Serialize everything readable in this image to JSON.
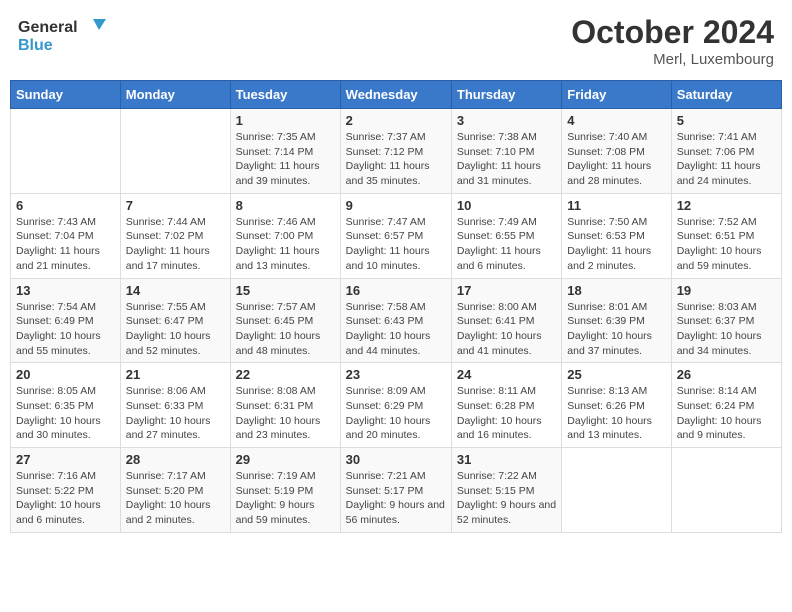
{
  "logo": {
    "general": "General",
    "blue": "Blue"
  },
  "title": "October 2024",
  "subtitle": "Merl, Luxembourg",
  "days_of_week": [
    "Sunday",
    "Monday",
    "Tuesday",
    "Wednesday",
    "Thursday",
    "Friday",
    "Saturday"
  ],
  "weeks": [
    [
      {
        "day": "",
        "info": ""
      },
      {
        "day": "",
        "info": ""
      },
      {
        "day": "1",
        "info": "Sunrise: 7:35 AM\nSunset: 7:14 PM\nDaylight: 11 hours and 39 minutes."
      },
      {
        "day": "2",
        "info": "Sunrise: 7:37 AM\nSunset: 7:12 PM\nDaylight: 11 hours and 35 minutes."
      },
      {
        "day": "3",
        "info": "Sunrise: 7:38 AM\nSunset: 7:10 PM\nDaylight: 11 hours and 31 minutes."
      },
      {
        "day": "4",
        "info": "Sunrise: 7:40 AM\nSunset: 7:08 PM\nDaylight: 11 hours and 28 minutes."
      },
      {
        "day": "5",
        "info": "Sunrise: 7:41 AM\nSunset: 7:06 PM\nDaylight: 11 hours and 24 minutes."
      }
    ],
    [
      {
        "day": "6",
        "info": "Sunrise: 7:43 AM\nSunset: 7:04 PM\nDaylight: 11 hours and 21 minutes."
      },
      {
        "day": "7",
        "info": "Sunrise: 7:44 AM\nSunset: 7:02 PM\nDaylight: 11 hours and 17 minutes."
      },
      {
        "day": "8",
        "info": "Sunrise: 7:46 AM\nSunset: 7:00 PM\nDaylight: 11 hours and 13 minutes."
      },
      {
        "day": "9",
        "info": "Sunrise: 7:47 AM\nSunset: 6:57 PM\nDaylight: 11 hours and 10 minutes."
      },
      {
        "day": "10",
        "info": "Sunrise: 7:49 AM\nSunset: 6:55 PM\nDaylight: 11 hours and 6 minutes."
      },
      {
        "day": "11",
        "info": "Sunrise: 7:50 AM\nSunset: 6:53 PM\nDaylight: 11 hours and 2 minutes."
      },
      {
        "day": "12",
        "info": "Sunrise: 7:52 AM\nSunset: 6:51 PM\nDaylight: 10 hours and 59 minutes."
      }
    ],
    [
      {
        "day": "13",
        "info": "Sunrise: 7:54 AM\nSunset: 6:49 PM\nDaylight: 10 hours and 55 minutes."
      },
      {
        "day": "14",
        "info": "Sunrise: 7:55 AM\nSunset: 6:47 PM\nDaylight: 10 hours and 52 minutes."
      },
      {
        "day": "15",
        "info": "Sunrise: 7:57 AM\nSunset: 6:45 PM\nDaylight: 10 hours and 48 minutes."
      },
      {
        "day": "16",
        "info": "Sunrise: 7:58 AM\nSunset: 6:43 PM\nDaylight: 10 hours and 44 minutes."
      },
      {
        "day": "17",
        "info": "Sunrise: 8:00 AM\nSunset: 6:41 PM\nDaylight: 10 hours and 41 minutes."
      },
      {
        "day": "18",
        "info": "Sunrise: 8:01 AM\nSunset: 6:39 PM\nDaylight: 10 hours and 37 minutes."
      },
      {
        "day": "19",
        "info": "Sunrise: 8:03 AM\nSunset: 6:37 PM\nDaylight: 10 hours and 34 minutes."
      }
    ],
    [
      {
        "day": "20",
        "info": "Sunrise: 8:05 AM\nSunset: 6:35 PM\nDaylight: 10 hours and 30 minutes."
      },
      {
        "day": "21",
        "info": "Sunrise: 8:06 AM\nSunset: 6:33 PM\nDaylight: 10 hours and 27 minutes."
      },
      {
        "day": "22",
        "info": "Sunrise: 8:08 AM\nSunset: 6:31 PM\nDaylight: 10 hours and 23 minutes."
      },
      {
        "day": "23",
        "info": "Sunrise: 8:09 AM\nSunset: 6:29 PM\nDaylight: 10 hours and 20 minutes."
      },
      {
        "day": "24",
        "info": "Sunrise: 8:11 AM\nSunset: 6:28 PM\nDaylight: 10 hours and 16 minutes."
      },
      {
        "day": "25",
        "info": "Sunrise: 8:13 AM\nSunset: 6:26 PM\nDaylight: 10 hours and 13 minutes."
      },
      {
        "day": "26",
        "info": "Sunrise: 8:14 AM\nSunset: 6:24 PM\nDaylight: 10 hours and 9 minutes."
      }
    ],
    [
      {
        "day": "27",
        "info": "Sunrise: 7:16 AM\nSunset: 5:22 PM\nDaylight: 10 hours and 6 minutes."
      },
      {
        "day": "28",
        "info": "Sunrise: 7:17 AM\nSunset: 5:20 PM\nDaylight: 10 hours and 2 minutes."
      },
      {
        "day": "29",
        "info": "Sunrise: 7:19 AM\nSunset: 5:19 PM\nDaylight: 9 hours and 59 minutes."
      },
      {
        "day": "30",
        "info": "Sunrise: 7:21 AM\nSunset: 5:17 PM\nDaylight: 9 hours and 56 minutes."
      },
      {
        "day": "31",
        "info": "Sunrise: 7:22 AM\nSunset: 5:15 PM\nDaylight: 9 hours and 52 minutes."
      },
      {
        "day": "",
        "info": ""
      },
      {
        "day": "",
        "info": ""
      }
    ]
  ]
}
